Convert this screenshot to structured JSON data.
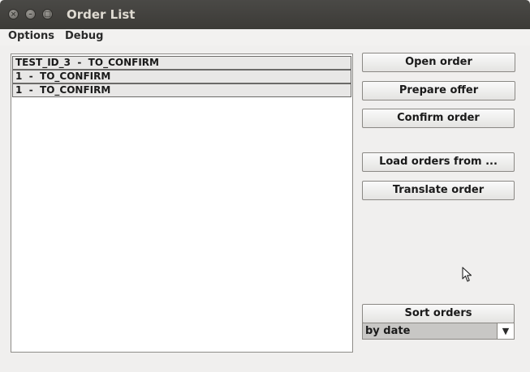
{
  "window": {
    "title": "Order List",
    "close_glyph": "×",
    "minimize_glyph": "–",
    "maximize_glyph": "□"
  },
  "menubar": {
    "items": [
      {
        "label": "Options"
      },
      {
        "label": "Debug"
      }
    ]
  },
  "order_list": {
    "rows": [
      {
        "text": "TEST_ID_3  -  TO_CONFIRM"
      },
      {
        "text": "1  -  TO_CONFIRM"
      },
      {
        "text": "1  -  TO_CONFIRM"
      }
    ]
  },
  "actions": {
    "open_order": "Open order",
    "prepare_offer": "Prepare offer",
    "confirm_order": "Confirm order",
    "load_orders": "Load orders from ...",
    "translate_order": "Translate order",
    "sort_orders": "Sort orders"
  },
  "sort": {
    "selected": "by date",
    "arrow_icon": "chevron-down-icon"
  },
  "colors": {
    "titlebar": "#3c3b37",
    "title_text": "#dfdbd2",
    "window_bg": "#f0efee",
    "row_bg": "#e8e7e6"
  }
}
